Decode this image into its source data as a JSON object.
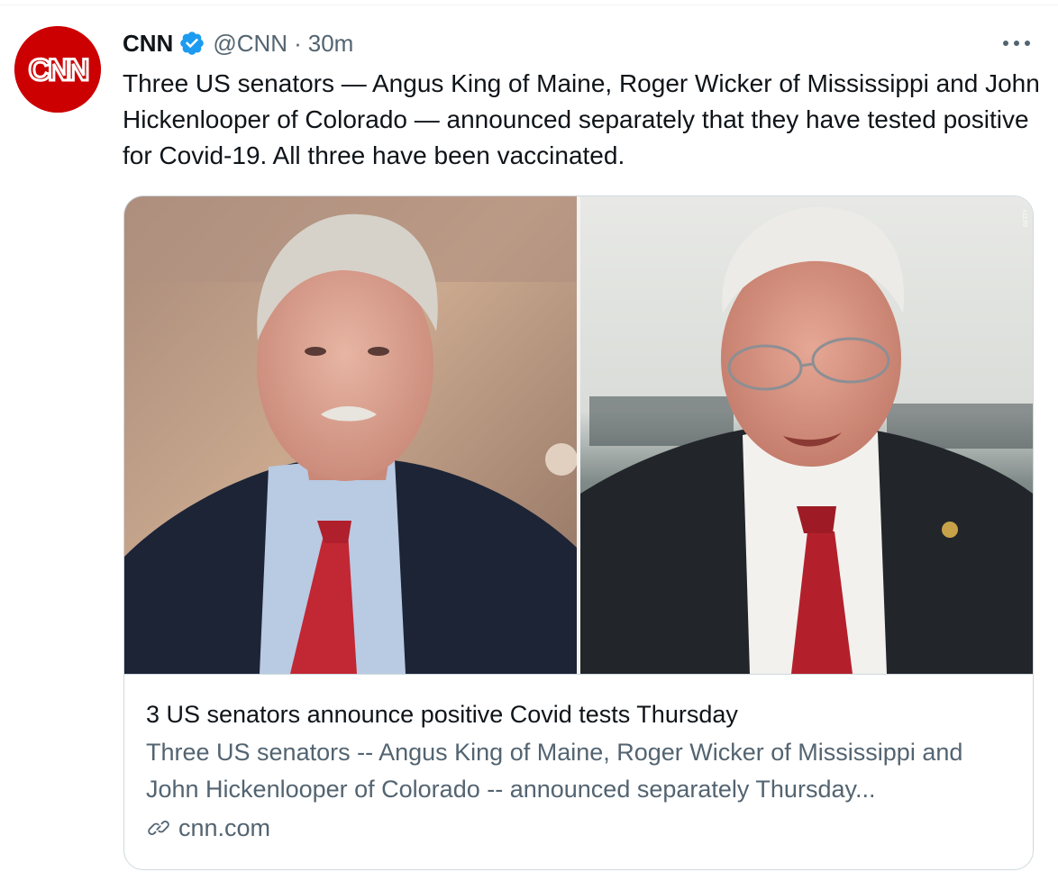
{
  "tweet": {
    "display_name": "CNN",
    "handle": "@CNN",
    "separator": "·",
    "time": "30m",
    "avatar_text": "CNN",
    "text": "Three US senators — Angus King of Maine, Roger Wicker of Mississippi and John Hickenlooper of Colorado — announced separately that they have tested positive for Covid-19. All three have been vaccinated.",
    "icons": {
      "verified": "verified-badge-icon",
      "more": "more-options-icon",
      "link": "link-icon"
    }
  },
  "card": {
    "title": "3 US senators announce positive Covid tests Thursday",
    "description": "Three US senators -- Angus King of Maine, Roger Wicker of Mississippi and John Hickenlooper of Colorado -- announced separately Thursday...",
    "domain": "cnn.com",
    "photo_credit": "GETTY"
  },
  "colors": {
    "brand": "#cc0000",
    "verified": "#1d9bf0",
    "text_primary": "#0f1419",
    "text_secondary": "#536471",
    "border": "#cfd9de"
  }
}
